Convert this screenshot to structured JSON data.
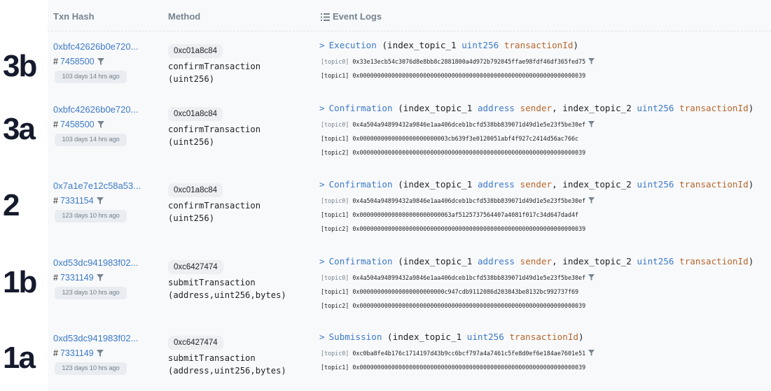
{
  "header": {
    "txn_hash": "Txn Hash",
    "method": "Method",
    "event_logs": "Event Logs"
  },
  "rows": [
    {
      "label": "3b",
      "hash": "0xbfc42626b0e720...",
      "block": "7458500",
      "age": "103 days 14 hrs ago",
      "method_id": "0xc01a8c84",
      "method_lines": [
        "confirmTransaction",
        "(uint256)"
      ],
      "event": {
        "name": "Execution",
        "open": "(",
        "parts": [
          "index_topic_1 ",
          "uint256",
          " ",
          "transactionId"
        ],
        "close": ")"
      },
      "topics": [
        {
          "label": "[topic0]",
          "value": "0x33e13ecb54c3076d8e8bb8c2881800a4d972b792045ffae98fdf46df365fed75"
        },
        {
          "label": "[topic1]",
          "value": "0x0000000000000000000000000000000000000000000000000000000000000039"
        }
      ]
    },
    {
      "label": "3a",
      "hash": "0xbfc42626b0e720...",
      "block": "7458500",
      "age": "103 days 14 hrs ago",
      "method_id": "0xc01a8c84",
      "method_lines": [
        "confirmTransaction",
        "(uint256)"
      ],
      "event": {
        "name": "Confirmation",
        "open": "(",
        "parts": [
          "index_topic_1 ",
          "address",
          " ",
          "sender",
          ", index_topic_2 ",
          "uint256",
          " ",
          "transactionId"
        ],
        "close": ")"
      },
      "topics": [
        {
          "label": "[topic0]",
          "value": "0x4a504a94899432a9846e1aa406dceb1bcfd538bb839071d49d1e5e23f5be30ef"
        },
        {
          "label": "[topic1]",
          "value": "0x0000000000000000000000003cb639f3e0120051abf4f927c2414d56ac766c"
        },
        {
          "label": "[topic2]",
          "value": "0x0000000000000000000000000000000000000000000000000000000000000039"
        }
      ]
    },
    {
      "label": "2",
      "hash": "0x7a1e7e12c58a53...",
      "block": "7331154",
      "age": "123 days 10 hrs ago",
      "method_id": "0xc01a8c84",
      "method_lines": [
        "confirmTransaction",
        "(uint256)"
      ],
      "event": {
        "name": "Confirmation",
        "open": "(",
        "parts": [
          "index_topic_1 ",
          "address",
          " ",
          "sender",
          ", index_topic_2 ",
          "uint256",
          " ",
          "transactionId"
        ],
        "close": ")"
      },
      "topics": [
        {
          "label": "[topic0]",
          "value": "0x4a504a94899432a9846e1aa406dceb1bcfd538bb839071d49d1e5e23f5be30ef"
        },
        {
          "label": "[topic1]",
          "value": "0x00000000000000000000000063af5125737564407a4081f017c34d647dad4f"
        },
        {
          "label": "[topic2]",
          "value": "0x0000000000000000000000000000000000000000000000000000000000000039"
        }
      ]
    },
    {
      "label": "1b",
      "hash": "0xd53dc941983f02...",
      "block": "7331149",
      "age": "123 days 10 hrs ago",
      "method_id": "0xc6427474",
      "method_lines": [
        "submitTransaction",
        "(address,uint256,bytes)"
      ],
      "event": {
        "name": "Confirmation",
        "open": "(",
        "parts": [
          "index_topic_1 ",
          "address",
          " ",
          "sender",
          ", index_topic_2 ",
          "uint256",
          " ",
          "transactionId"
        ],
        "close": ")"
      },
      "topics": [
        {
          "label": "[topic0]",
          "value": "0x4a504a94899432a9846e1aa406dceb1bcfd538bb839071d49d1e5e23f5be30ef"
        },
        {
          "label": "[topic1]",
          "value": "0x000000000000000000000000c947cdb9112086d203843be8132bc992737f69"
        },
        {
          "label": "[topic2]",
          "value": "0x0000000000000000000000000000000000000000000000000000000000000039"
        }
      ]
    },
    {
      "label": "1a",
      "hash": "0xd53dc941983f02...",
      "block": "7331149",
      "age": "123 days 10 hrs ago",
      "method_id": "0xc6427474",
      "method_lines": [
        "submitTransaction",
        "(address,uint256,bytes)"
      ],
      "event": {
        "name": "Submission",
        "open": "(",
        "parts": [
          "index_topic_1 ",
          "uint256",
          " ",
          "transactionId"
        ],
        "close": ")"
      },
      "topics": [
        {
          "label": "[topic0]",
          "value": "0xc0ba8fe4b176c1714197d43b9cc6bcf797a4a7461c5fe8d0ef6e184ae7601e51"
        },
        {
          "label": "[topic1]",
          "value": "0x0000000000000000000000000000000000000000000000000000000000000039"
        }
      ]
    }
  ],
  "colors": {
    "link": "#3d7ac8",
    "param_name": "#b7672b",
    "muted": "#77838f",
    "badge_bg": "#edeff2",
    "panel_bg": "#f8f9fb"
  },
  "icons": [
    "list-icon",
    "filter-icon",
    "chevron-right-icon"
  ]
}
